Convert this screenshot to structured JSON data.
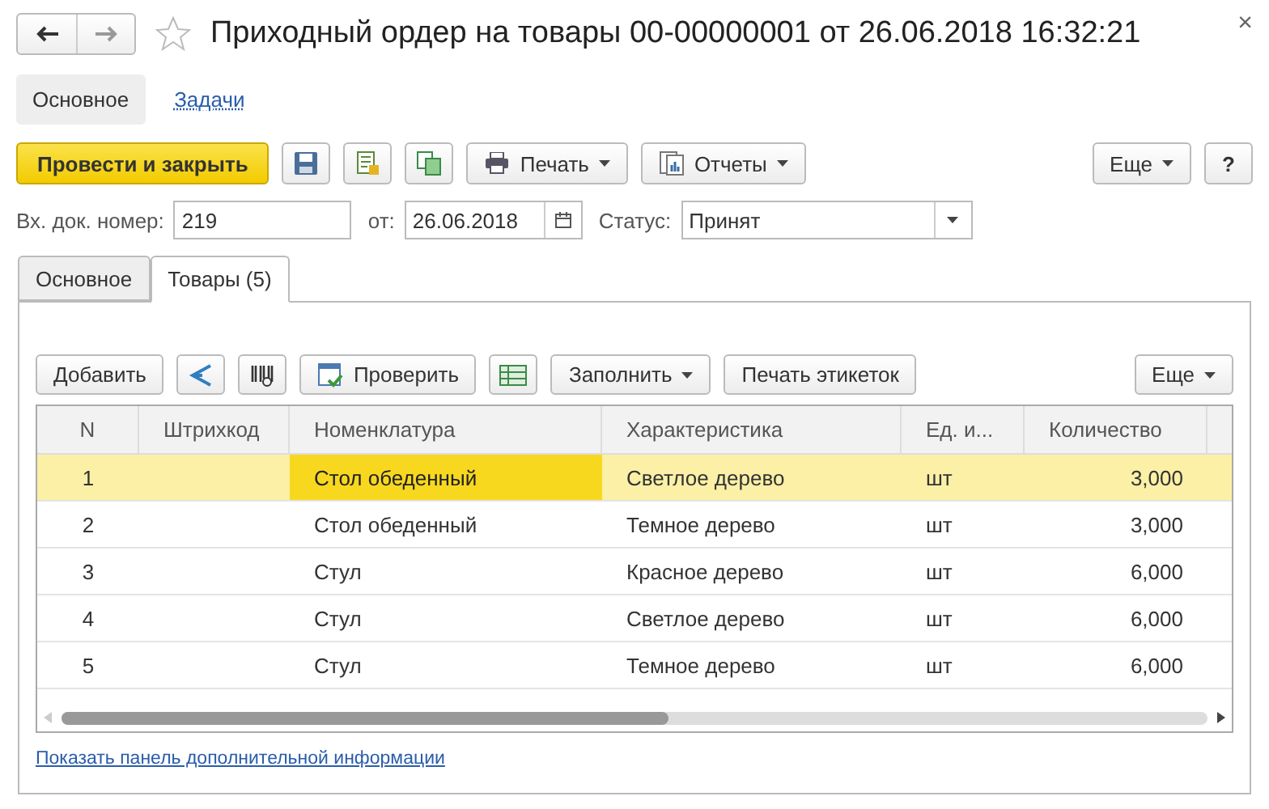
{
  "window": {
    "close": "×"
  },
  "header": {
    "title": "Приходный ордер на товары 00-00000001 от 26.06.2018 16:32:21",
    "favorite": false
  },
  "sections": [
    {
      "label": "Основное",
      "selected": true
    },
    {
      "label": "Задачи",
      "selected": false
    }
  ],
  "toolbar": [
    {
      "kind": "primary",
      "label": "Провести и закрыть"
    },
    {
      "kind": "icon"
    },
    {
      "kind": "icon"
    },
    {
      "kind": "icon"
    },
    {
      "kind": "menu",
      "label": "Печать"
    },
    {
      "kind": "menu",
      "label": "Отчеты"
    },
    {
      "kind": "spacer"
    },
    {
      "kind": "menu",
      "label": "Еще"
    },
    {
      "kind": "button",
      "label": "?"
    }
  ],
  "fields": {
    "number_label": "Вх. док. номер:",
    "number": "219",
    "date_label": "от:",
    "date": "26.06.2018",
    "status_label": "Статус:",
    "status": "Принят"
  },
  "tabs": [
    {
      "label": "Основное",
      "selected": false
    },
    {
      "label": "Товары (5)",
      "selected": true
    }
  ],
  "table_toolbar": [
    {
      "kind": "button",
      "label": "Добавить"
    },
    {
      "kind": "icon"
    },
    {
      "kind": "icon"
    },
    {
      "kind": "button",
      "label": "Проверить"
    },
    {
      "kind": "icon"
    },
    {
      "kind": "menu",
      "label": "Заполнить"
    },
    {
      "kind": "button",
      "label": "Печать этикеток"
    },
    {
      "kind": "spacer"
    },
    {
      "kind": "menu",
      "label": "Еще"
    }
  ],
  "table": {
    "columns": [
      "N",
      "Штрихкод",
      "Номенклатура",
      "Характеристика",
      "Ед. и...",
      "Количество"
    ],
    "rows": [
      {
        "selected": true,
        "cells": [
          {
            "text": "1",
            "focused": false
          },
          {
            "focused": false
          },
          {
            "text": "Стол обеденный",
            "focused": true
          },
          {
            "text": "Светлое дерево",
            "focused": false
          },
          {
            "text": "шт",
            "focused": false
          },
          {
            "text": "3,000",
            "focused": false
          }
        ]
      },
      {
        "selected": false,
        "cells": [
          {
            "text": "2",
            "focused": false
          },
          {
            "focused": false
          },
          {
            "text": "Стол обеденный",
            "focused": false
          },
          {
            "text": "Темное дерево",
            "focused": false
          },
          {
            "text": "шт",
            "focused": false
          },
          {
            "text": "3,000",
            "focused": false
          }
        ]
      },
      {
        "selected": false,
        "cells": [
          {
            "text": "3",
            "focused": false
          },
          {
            "focused": false
          },
          {
            "text": "Стул",
            "focused": false
          },
          {
            "text": "Красное дерево",
            "focused": false
          },
          {
            "text": "шт",
            "focused": false
          },
          {
            "text": "6,000",
            "focused": false
          }
        ]
      },
      {
        "selected": false,
        "cells": [
          {
            "text": "4",
            "focused": false
          },
          {
            "focused": false
          },
          {
            "text": "Стул",
            "focused": false
          },
          {
            "text": "Светлое дерево",
            "focused": false
          },
          {
            "text": "шт",
            "focused": false
          },
          {
            "text": "6,000",
            "focused": false
          }
        ]
      },
      {
        "selected": false,
        "cells": [
          {
            "text": "5",
            "focused": false
          },
          {
            "focused": false
          },
          {
            "text": "Стул",
            "focused": false
          },
          {
            "text": "Темное дерево",
            "focused": false
          },
          {
            "text": "шт",
            "focused": false
          },
          {
            "text": "6,000",
            "focused": false
          }
        ]
      }
    ]
  },
  "info_link": "Показать панель дополнительной информации"
}
